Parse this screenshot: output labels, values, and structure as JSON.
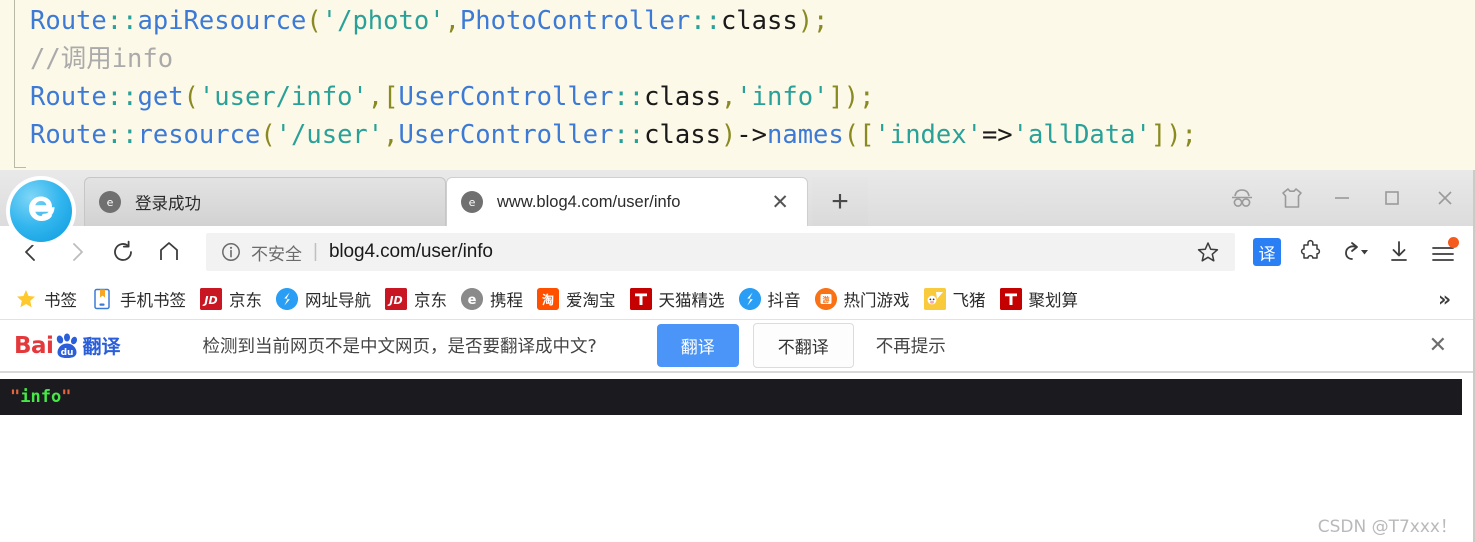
{
  "editor": {
    "lines": [
      [
        {
          "t": "Route",
          "c": "tk-cls"
        },
        {
          "t": "::",
          "c": "tk-op"
        },
        {
          "t": "apiResource",
          "c": "tk-fn"
        },
        {
          "t": "(",
          "c": "tk-paren"
        },
        {
          "t": "'/photo'",
          "c": "tk-str"
        },
        {
          "t": ",",
          "c": "tk-paren"
        },
        {
          "t": "PhotoController",
          "c": "tk-cls"
        },
        {
          "t": "::",
          "c": "tk-op"
        },
        {
          "t": "class",
          "c": "tk-plain"
        },
        {
          "t": ");",
          "c": "tk-paren"
        }
      ],
      [
        {
          "t": "//调用info",
          "c": "tk-cmt"
        }
      ],
      [
        {
          "t": "Route",
          "c": "tk-cls"
        },
        {
          "t": "::",
          "c": "tk-op"
        },
        {
          "t": "get",
          "c": "tk-fn"
        },
        {
          "t": "(",
          "c": "tk-paren"
        },
        {
          "t": "'user/info'",
          "c": "tk-str"
        },
        {
          "t": ",",
          "c": "tk-paren"
        },
        {
          "t": "[",
          "c": "tk-paren"
        },
        {
          "t": "UserController",
          "c": "tk-cls"
        },
        {
          "t": "::",
          "c": "tk-op"
        },
        {
          "t": "class",
          "c": "tk-plain"
        },
        {
          "t": ",",
          "c": "tk-paren"
        },
        {
          "t": "'info'",
          "c": "tk-str"
        },
        {
          "t": "]);",
          "c": "tk-paren"
        }
      ],
      [
        {
          "t": "Route",
          "c": "tk-cls"
        },
        {
          "t": "::",
          "c": "tk-op"
        },
        {
          "t": "resource",
          "c": "tk-fn"
        },
        {
          "t": "(",
          "c": "tk-paren"
        },
        {
          "t": "'/user'",
          "c": "tk-str"
        },
        {
          "t": ",",
          "c": "tk-paren"
        },
        {
          "t": "UserController",
          "c": "tk-cls"
        },
        {
          "t": "::",
          "c": "tk-op"
        },
        {
          "t": "class",
          "c": "tk-plain"
        },
        {
          "t": ")",
          "c": "tk-paren"
        },
        {
          "t": "->",
          "c": "tk-plain"
        },
        {
          "t": "names",
          "c": "tk-fn"
        },
        {
          "t": "([",
          "c": "tk-paren"
        },
        {
          "t": "'index'",
          "c": "tk-str"
        },
        {
          "t": "=>",
          "c": "tk-plain"
        },
        {
          "t": "'allData'",
          "c": "tk-str"
        },
        {
          "t": "]);",
          "c": "tk-paren"
        }
      ]
    ]
  },
  "browser": {
    "tabs": [
      {
        "title": "登录成功",
        "active": false
      },
      {
        "title": "www.blog4.com/user/info",
        "active": true
      }
    ],
    "tab_close_label": "✕",
    "newtab_label": "+",
    "window_controls": {
      "minimize": "—",
      "maximize": "▢",
      "close": "✕"
    },
    "toolbar": {
      "back": "‹",
      "forward": "›",
      "reload": "⟳",
      "home": "⌂",
      "security_label": "不安全",
      "separator": "|",
      "url": "blog4.com/user/info",
      "translate_badge": "译",
      "undo_caret": "▾"
    },
    "bookmarks": {
      "items": [
        {
          "label": "书签",
          "icon": "star-icon",
          "icon_text": "",
          "cls": "ic-star"
        },
        {
          "label": "手机书签",
          "icon": "phone-bookmark-icon",
          "icon_text": "",
          "cls": "ic-mb"
        },
        {
          "label": "京东",
          "icon": "jd-icon",
          "icon_text": "JD",
          "cls": "ic-jd"
        },
        {
          "label": "网址导航",
          "icon": "navigation-icon",
          "icon_text": "S",
          "cls": "ic-nav"
        },
        {
          "label": "京东",
          "icon": "jd-icon",
          "icon_text": "JD",
          "cls": "ic-jd"
        },
        {
          "label": "携程",
          "icon": "ctrip-icon",
          "icon_text": "e",
          "cls": "ic-ctrip"
        },
        {
          "label": "爱淘宝",
          "icon": "taobao-icon",
          "icon_text": "淘",
          "cls": "ic-taob"
        },
        {
          "label": "天猫精选",
          "icon": "tmall-icon",
          "icon_text": "T",
          "cls": "ic-tmall"
        },
        {
          "label": "抖音",
          "icon": "douyin-icon",
          "icon_text": "S",
          "cls": "ic-dy"
        },
        {
          "label": "热门游戏",
          "icon": "games-icon",
          "icon_text": "游",
          "cls": "ic-game"
        },
        {
          "label": "飞猪",
          "icon": "fliggy-icon",
          "icon_text": "",
          "cls": "ic-fz"
        },
        {
          "label": "聚划算",
          "icon": "juhuasuan-icon",
          "icon_text": "T",
          "cls": "ic-juh"
        }
      ],
      "overflow_label": "»"
    }
  },
  "notification": {
    "logo_bai": "Bai",
    "logo_du": "du",
    "logo_fanyi": "翻译",
    "message": "检测到当前网页不是中文网页，是否要翻译成中文?",
    "translate_button": "翻译",
    "no_translate_button": "不翻译",
    "never_link": "不再提示",
    "close_label": "✕"
  },
  "page_content": {
    "json_quote_open": "\"",
    "json_value": "info",
    "json_quote_close": "\"",
    "watermark": "CSDN @T7xxx！"
  },
  "colors": {
    "editor_bg": "#fdf9e8",
    "accent_blue": "#2b7ff5",
    "baidu_red": "#e4393c",
    "baidu_blue": "#2b5fd9",
    "json_bg": "#1b1b1f",
    "json_string": "#45e845",
    "json_quote": "#e8643c",
    "menu_dot": "#f55a1e"
  }
}
